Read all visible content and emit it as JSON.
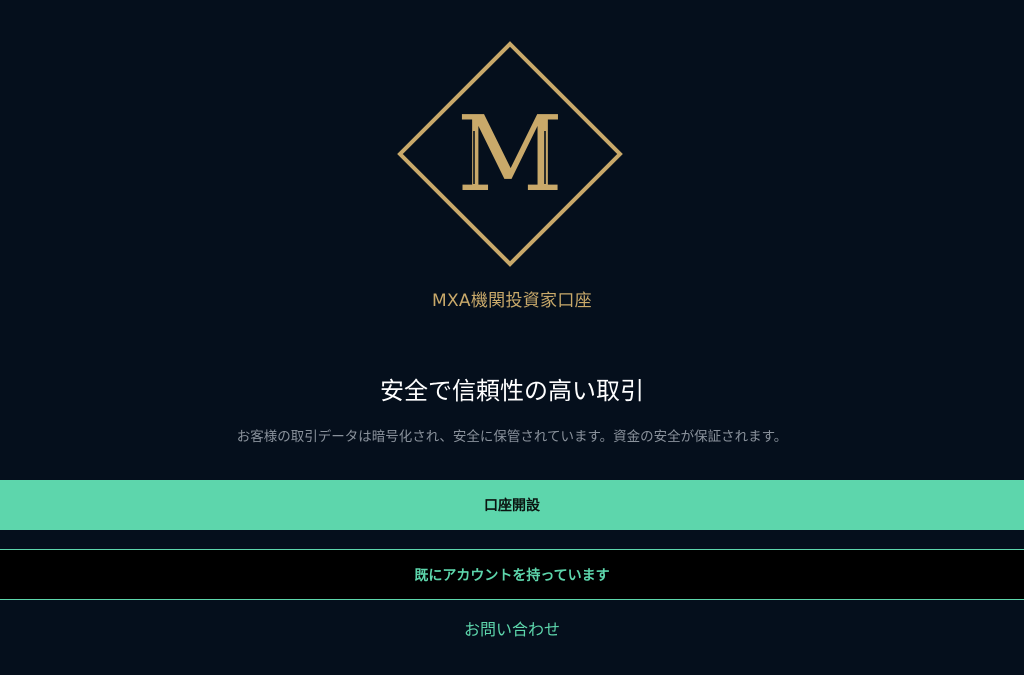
{
  "brand": {
    "name": "MXA機関投資家口座",
    "logo_letter": "M",
    "logo_icon": "diamond-monogram-logo"
  },
  "hero": {
    "headline": "安全で信頼性の高い取引",
    "subtext": "お客様の取引データは暗号化され、安全に保管されています。資金の安全が保証されます。"
  },
  "actions": {
    "open_account_label": "口座開設",
    "have_account_label": "既にアカウントを持っています",
    "contact_label": "お問い合わせ"
  },
  "colors": {
    "background": "#050f1c",
    "gold": "#c9a96a",
    "accent": "#5dd6ac",
    "secondary_bg": "#000000",
    "subtext": "#8a929c"
  }
}
